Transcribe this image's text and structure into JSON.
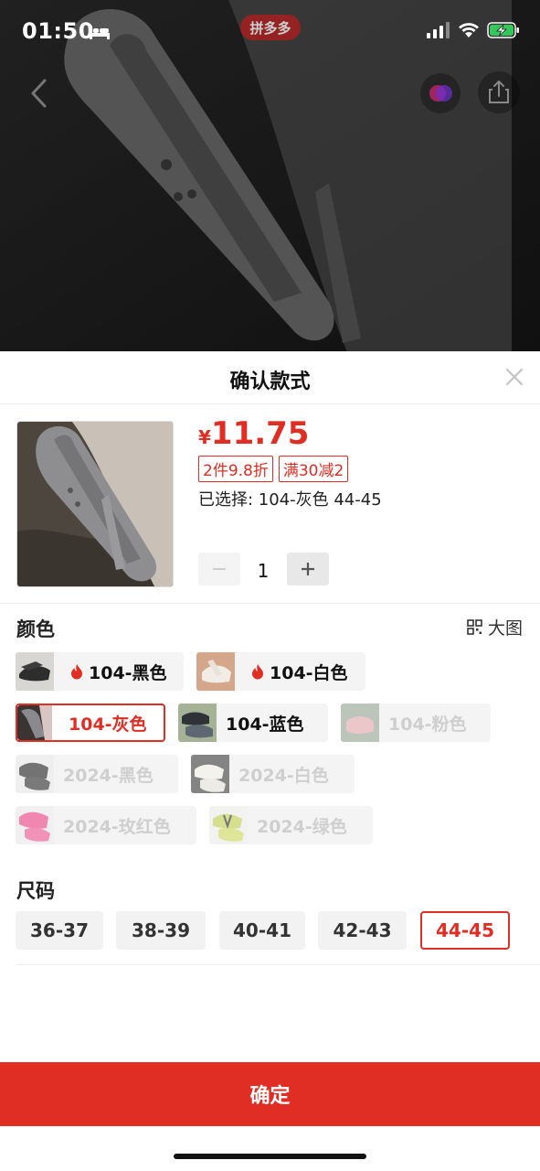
{
  "status_bar": {
    "time": "01:50",
    "brand": "拼多多"
  },
  "sheet": {
    "title": "确认款式",
    "price": {
      "currency": "¥",
      "amount": "11.75"
    },
    "promo_tags": [
      "2件9.8折",
      "满30减2"
    ],
    "selected": "已选择: 104-灰色 44-45",
    "quantity": "1",
    "color_section": {
      "title": "颜色",
      "big_image_label": "大图",
      "options": [
        {
          "label": "104-黑色",
          "hot": true,
          "state": "normal",
          "thumb": "#3a3a3a"
        },
        {
          "label": "104-白色",
          "hot": true,
          "state": "normal",
          "thumb": "#e9e4dc"
        },
        {
          "label": "104-灰色",
          "hot": false,
          "state": "selected",
          "thumb": "#7a7a7e"
        },
        {
          "label": "104-蓝色",
          "hot": false,
          "state": "normal",
          "thumb": "#5c6a78"
        },
        {
          "label": "104-粉色",
          "hot": false,
          "state": "disabled",
          "thumb": "#e6b3b7"
        },
        {
          "label": "2024-黑色",
          "hot": false,
          "state": "disabled",
          "thumb": "#222222"
        },
        {
          "label": "2024-白色",
          "hot": false,
          "state": "disabled",
          "thumb": "#f0efe9"
        },
        {
          "label": "2024-玫红色",
          "hot": false,
          "state": "disabled",
          "thumb": "#ef4e8c"
        },
        {
          "label": "2024-绿色",
          "hot": false,
          "state": "disabled",
          "thumb": "#c9d65a"
        }
      ]
    },
    "size_section": {
      "title": "尺码",
      "options": [
        {
          "label": "36-37",
          "state": "normal"
        },
        {
          "label": "38-39",
          "state": "normal"
        },
        {
          "label": "40-41",
          "state": "normal"
        },
        {
          "label": "42-43",
          "state": "normal"
        },
        {
          "label": "44-45",
          "state": "selected"
        }
      ]
    },
    "confirm_label": "确定"
  },
  "colors": {
    "accent": "#e02e24",
    "chip_bg": "#f4f4f4",
    "disabled_text": "#cfcfcf"
  }
}
